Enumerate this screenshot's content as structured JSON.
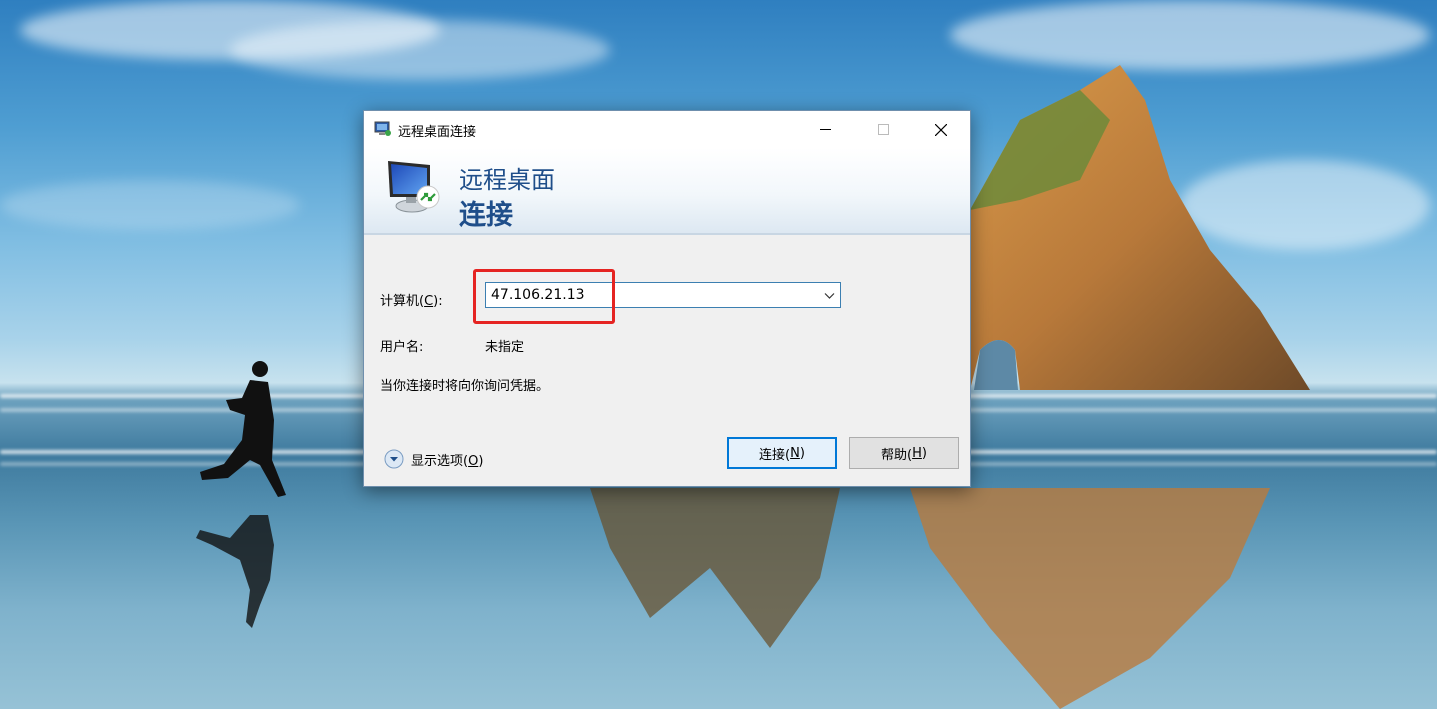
{
  "window": {
    "title": "远程桌面连接",
    "controls": {
      "minimize": "minimize",
      "maximize": "maximize",
      "close": "close"
    }
  },
  "banner": {
    "line1": "远程桌面",
    "line2": "连接"
  },
  "form": {
    "computer_label": "计算机(",
    "computer_accel": "C",
    "computer_label_end": "):",
    "computer_value": "47.106.21.13",
    "username_label": "用户名:",
    "username_value": "未指定",
    "credentials_note": "当你连接时将向你询问凭据。"
  },
  "options": {
    "label": "显示选项(",
    "accel": "O",
    "label_end": ")"
  },
  "buttons": {
    "connect": "连接(",
    "connect_accel": "N",
    "connect_end": ")",
    "help": "帮助(",
    "help_accel": "H",
    "help_end": ")"
  },
  "colors": {
    "accent": "#0078d7",
    "banner_text": "#1f4e8a",
    "highlight_box": "#e52422"
  },
  "icons": [
    "remote-desktop-icon",
    "chevron-down-icon",
    "options-expand-icon",
    "minimize-icon",
    "maximize-icon",
    "close-icon"
  ]
}
